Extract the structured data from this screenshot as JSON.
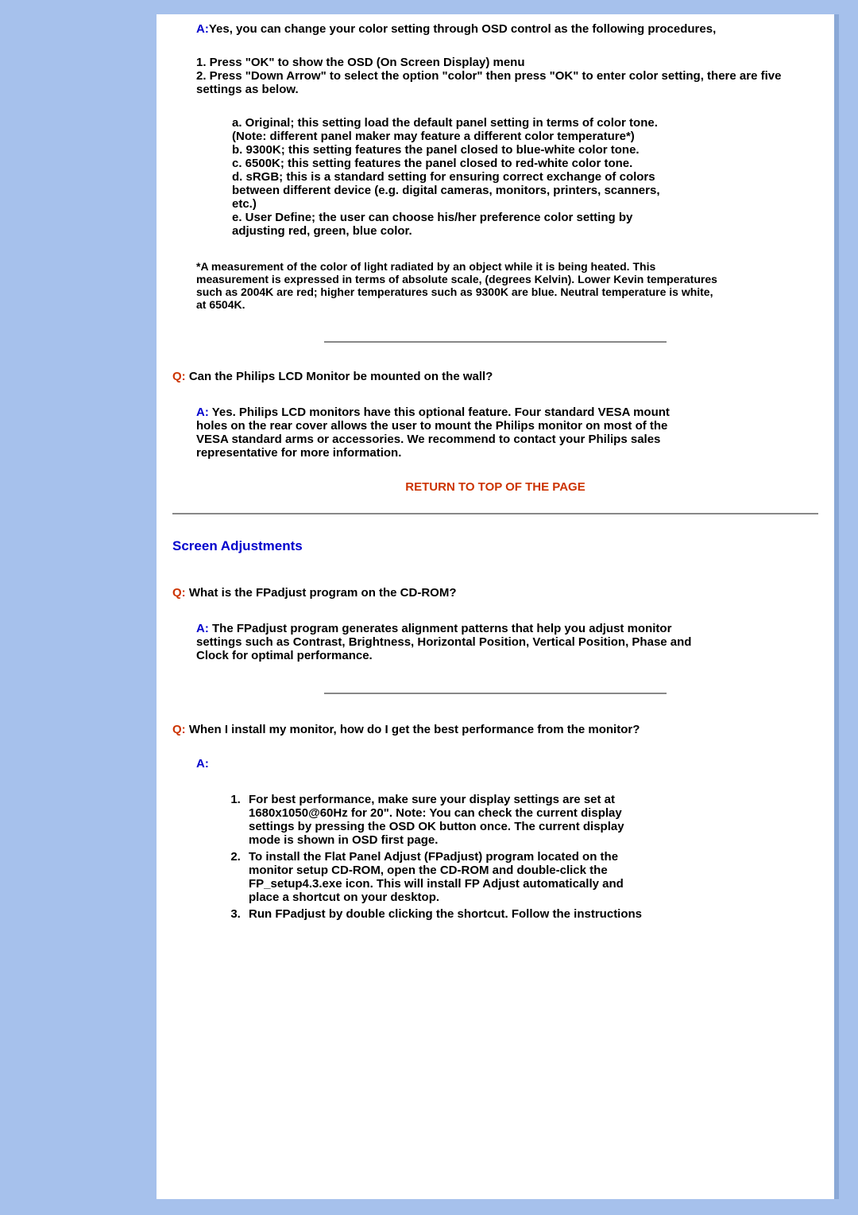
{
  "faq1": {
    "a_label": "A:",
    "a_intro": "Yes, you can change your color setting through OSD control as the following procedures,",
    "step1": "1. Press \"OK\" to show the OSD (On Screen Display) menu",
    "step2": "2. Press \"Down Arrow\" to select the option \"color\" then press \"OK\" to enter color setting, there are five settings as below.",
    "opt_a": "a. Original; this setting load the default panel setting in terms of color tone. (Note: different panel maker may feature a different color temperature*)",
    "opt_b": "b. 9300K; this setting features the panel closed to blue-white color tone.",
    "opt_c": "c. 6500K; this setting features the panel closed to red-white color tone.",
    "opt_d": "d. sRGB; this is a standard setting for ensuring correct exchange of colors between different device (e.g. digital cameras, monitors, printers, scanners, etc.)",
    "opt_e": "e. User Define; the user can choose his/her preference color setting by adjusting red, green, blue color.",
    "footnote": "*A measurement of the color of light radiated by an object while it is being heated. This measurement is expressed in terms of absolute scale, (degrees Kelvin). Lower Kevin temperatures such as 2004K are red; higher temperatures such as 9300K are blue. Neutral temperature is white, at 6504K."
  },
  "faq2": {
    "q_label": "Q:",
    "q_text": " Can the Philips LCD Monitor be mounted on the wall?",
    "a_label": "A:",
    "a_text": " Yes. Philips LCD monitors have this optional feature. Four standard VESA mount holes on the rear cover allows the user to mount the Philips monitor on most of the VESA standard arms or accessories. We recommend to contact your Philips sales representative for more information."
  },
  "return_link": "RETURN TO TOP OF THE PAGE",
  "section_title": "Screen Adjustments",
  "faq3": {
    "q_label": "Q:",
    "q_text": " What is the FPadjust program on the CD-ROM?",
    "a_label": "A:",
    "a_text": " The FPadjust program generates alignment patterns that help you adjust monitor settings such as Contrast, Brightness, Horizontal Position, Vertical Position, Phase and Clock for optimal performance."
  },
  "faq4": {
    "q_label": "Q:",
    "q_text": " When I install my monitor, how do I get the best performance from the monitor?",
    "a_label": "A:",
    "li1": "For best performance, make sure your display settings are set at 1680x1050@60Hz for 20\". Note: You can check the current display settings by pressing the OSD OK button once. The current display mode is shown in OSD first page.",
    "li2": "To install the Flat Panel Adjust (FPadjust) program located on the monitor setup CD-ROM, open the CD-ROM and double-click the FP_setup4.3.exe icon. This will install FP Adjust automatically and place a shortcut on your desktop.",
    "li3": "Run FPadjust by double clicking the shortcut. Follow the instructions"
  }
}
